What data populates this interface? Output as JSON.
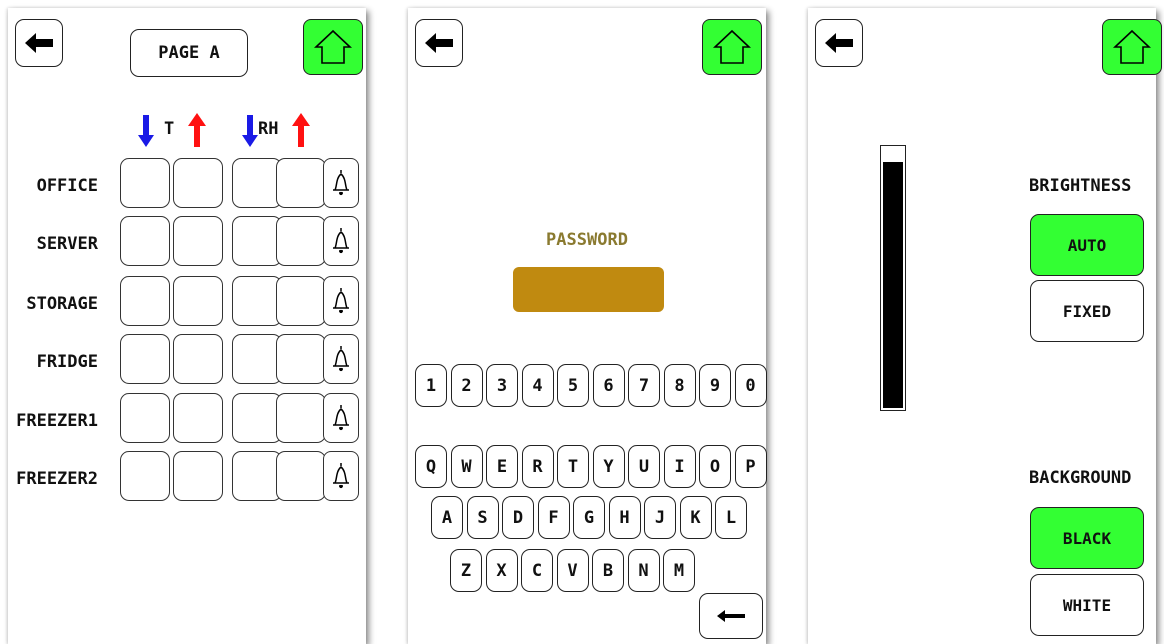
{
  "colors": {
    "home": "#33ff33",
    "down_arrow": "#1a1ae6",
    "up_arrow": "#ff1111",
    "password_field": "#c08a10",
    "password_label": "#8a7a30",
    "selected": "#33ff33"
  },
  "page_a": {
    "title": "PAGE A",
    "headers": {
      "temperature": "T",
      "humidity": "RH"
    },
    "rows": [
      "OFFICE",
      "SERVER",
      "STORAGE",
      "FRIDGE",
      "FREEZER1",
      "FREEZER2"
    ]
  },
  "password_screen": {
    "label": "PASSWORD",
    "value": "",
    "digits": [
      "1",
      "2",
      "3",
      "4",
      "5",
      "6",
      "7",
      "8",
      "9",
      "0"
    ],
    "row1": [
      "Q",
      "W",
      "E",
      "R",
      "T",
      "Y",
      "U",
      "I",
      "O",
      "P"
    ],
    "row2": [
      "A",
      "S",
      "D",
      "F",
      "G",
      "H",
      "J",
      "K",
      "L"
    ],
    "row3": [
      "Z",
      "X",
      "C",
      "V",
      "B",
      "N",
      "M"
    ]
  },
  "settings": {
    "brightness_label": "BRIGHTNESS",
    "brightness_options": [
      "AUTO",
      "FIXED"
    ],
    "brightness_selected": "AUTO",
    "brightness_level": 0.95,
    "background_label": "BACKGROUND",
    "background_options": [
      "BLACK",
      "WHITE"
    ],
    "background_selected": "BLACK"
  }
}
